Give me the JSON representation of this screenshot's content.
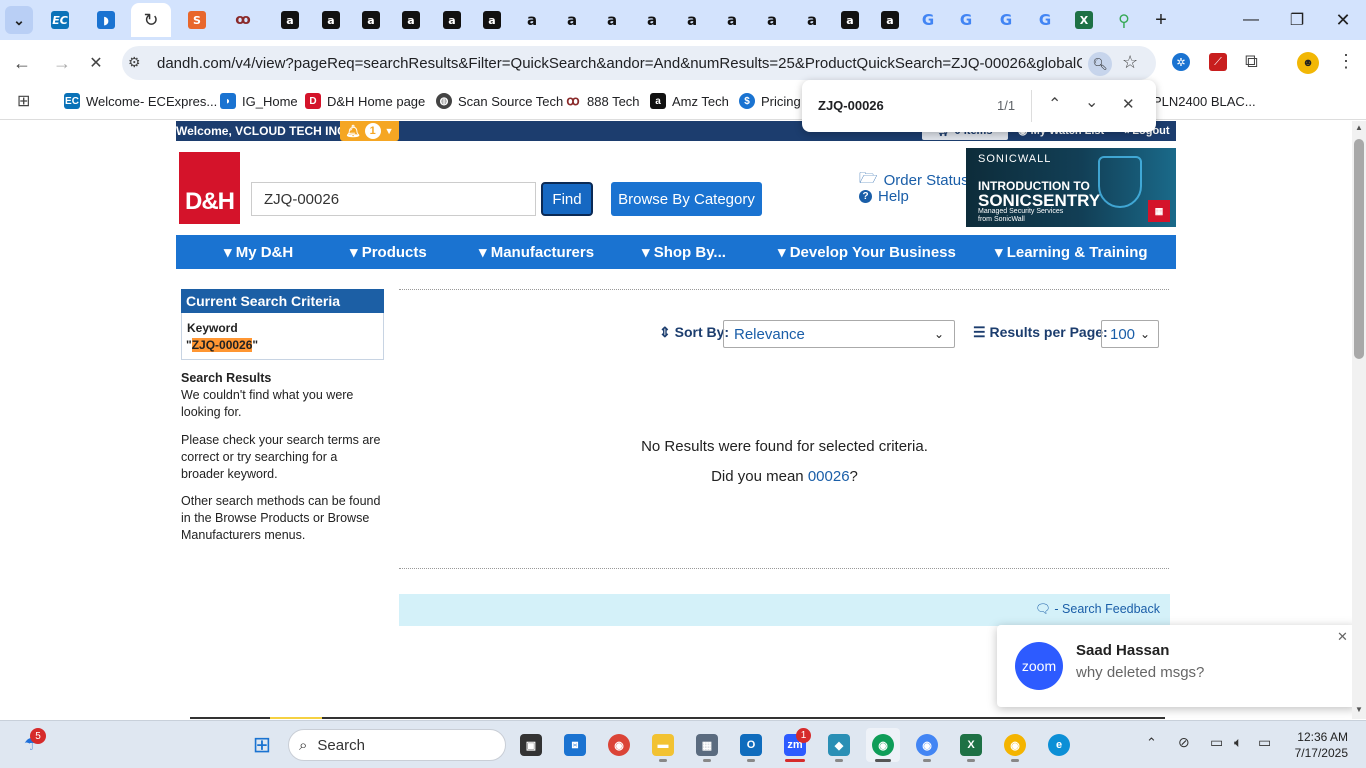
{
  "browser": {
    "url": "dandh.com/v4/view?pageReq=searchResults&Filter=QuickSearch&andor=And&numResults=25&ProductQuickSearch=ZJQ-00026&globalCSP=e51...",
    "tabs_amazon_glyph": "a",
    "tabs_google_glyph": "G",
    "bookmarks": [
      {
        "label": "Welcome- ECExpres...",
        "icon": "ec-icon"
      },
      {
        "label": "IG_Home",
        "icon": "ig-icon"
      },
      {
        "label": "D&H Home page",
        "icon": "dh-icon"
      },
      {
        "label": "Scan Source Tech",
        "icon": "globe-icon"
      },
      {
        "label": "888 Tech",
        "icon": "888-icon"
      },
      {
        "label": "Amz Tech",
        "icon": "amazon-icon"
      },
      {
        "label": "Pricing",
        "icon": "dollar-icon"
      }
    ],
    "bookmark_overflow": "PLN2400 BLAC...",
    "find": {
      "query": "ZJQ-00026",
      "count": "1/1"
    }
  },
  "site": {
    "welcome": "Welcome, VCLOUD TECH INC",
    "notification_count": "1",
    "cart_label": "0 items",
    "watch_list": "My Watch List",
    "logout": "Logout",
    "logo_text": "D&H",
    "search_value": "ZJQ-00026",
    "find_label": "Find",
    "browse_label": "Browse By Category",
    "order_status": "Order Status",
    "help": "Help",
    "banner": {
      "brand": "SONICWALL",
      "line1": "INTRODUCTION TO",
      "line2": "SONICSENTRY",
      "line3": "Managed Security Services",
      "line4": "from SonicWall"
    },
    "nav": [
      "My D&H",
      "Products",
      "Manufacturers",
      "Shop By...",
      "Develop Your Business",
      "Learning & Training"
    ]
  },
  "sidebar": {
    "header": "Current Search Criteria",
    "keyword_label": "Keyword",
    "keyword_open": "\"",
    "keyword_value": "ZJQ-00026",
    "keyword_close": "\"",
    "results_title": "Search Results",
    "p1": "We couldn't find what you were looking for.",
    "p2": "Please check your search terms are correct or try searching for a broader keyword.",
    "p3": "Other search methods can be found in the Browse Products or Browse Manufacturers menus."
  },
  "results": {
    "sort_label": "Sort By:",
    "sort_value": "Relevance",
    "rpp_label": "Results per Page:",
    "rpp_value": "100",
    "no_results": "No Results were found for selected criteria.",
    "did_you_mean": "Did you mean",
    "suggestion": "00026",
    "qmark": "?",
    "feedback": "- Search Feedback"
  },
  "toast": {
    "app": "zoom",
    "sender": "Saad Hassan",
    "message": "why deleted msgs?"
  },
  "taskbar": {
    "search_placeholder": "Search",
    "time": "12:36 AM",
    "date": "7/17/2025",
    "weather_badge": "5",
    "zoom_badge": "1"
  }
}
